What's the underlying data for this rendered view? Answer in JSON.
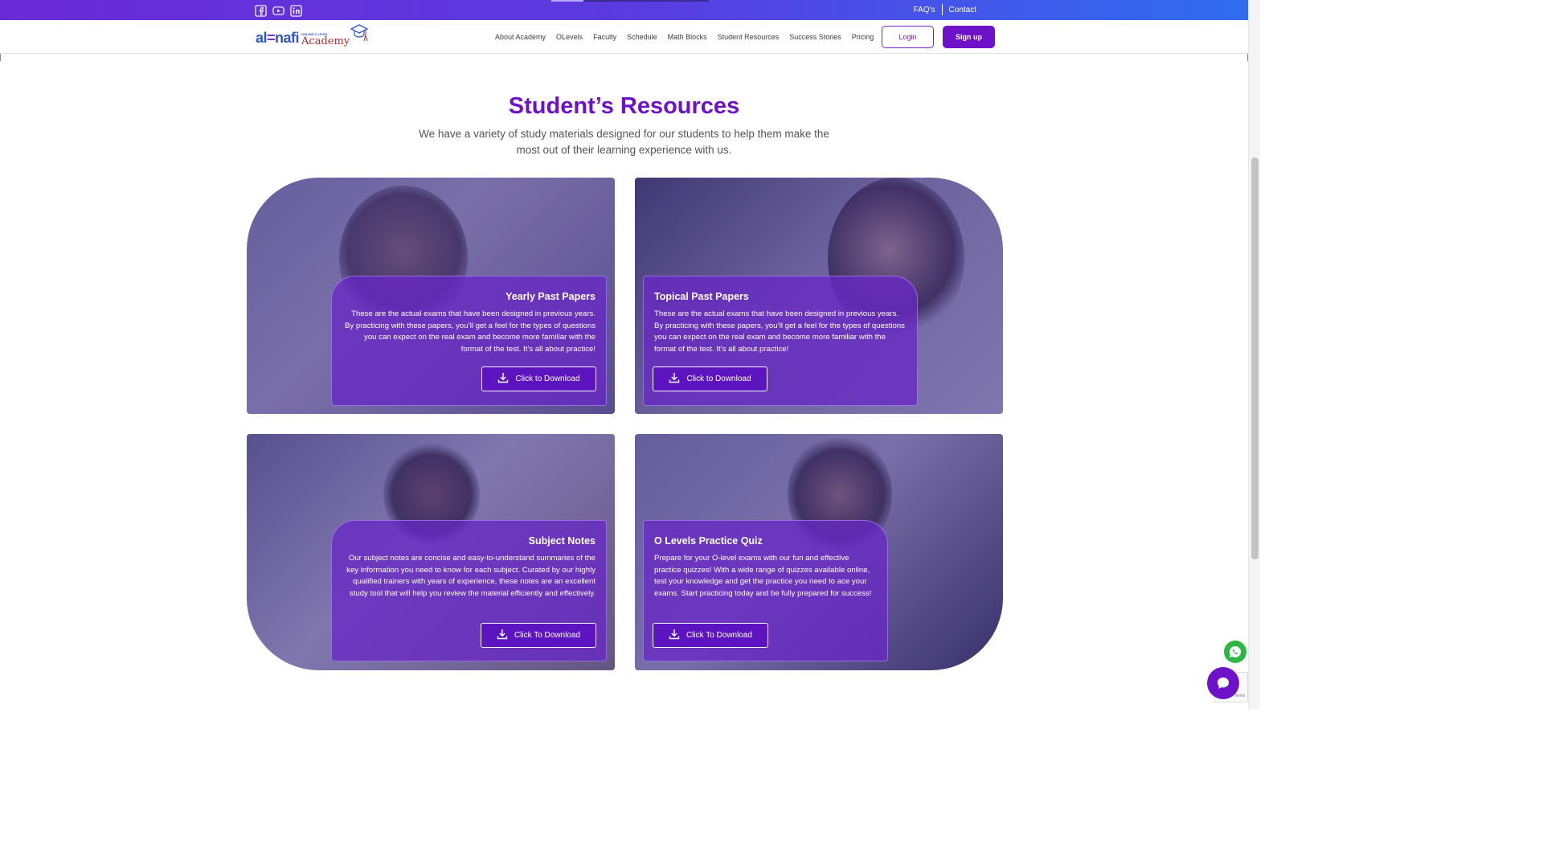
{
  "topbar": {
    "links": [
      "FAQ's",
      "Contact"
    ]
  },
  "nav": {
    "logo": {
      "main_left": "al",
      "main_eq": "=",
      "main_right": "nafi",
      "tagline": "ONLINE O LEVEL",
      "academy": "Academy"
    },
    "items": [
      "About Academy",
      "OLevels",
      "Faculty",
      "Schedule",
      "Math Blocks",
      "Student Resources",
      "Success Stories",
      "Pricing"
    ],
    "login": "Login",
    "signup": "Sign up"
  },
  "section": {
    "title": "Student’s Resources",
    "subtitle": "We have a variety of study materials designed for our students to help them make the most out of their learning experience with us."
  },
  "cards": [
    {
      "title": "Yearly Past Papers",
      "text": "These are the actual exams that have been designed in previous years. By practicing with these papers, you’ll get a feel for the types of questions you can expect on the real exam and become more familiar with the format of the test. It’s all about practice!",
      "button": "Click to Download"
    },
    {
      "title": "Topical Past Papers",
      "text": "These are the actual exams that have been designed in previous years. By practicing with these papers, you’ll get a feel for the types of questions you can expect on the real exam and become more familiar with the format of the test. It’s all about practice!",
      "button": "Click to Download"
    },
    {
      "title": "Subject Notes",
      "text": "Our subject notes are concise and easy-to-understand summaries of the key information you need to know for each subject. Curated by our highly qualified trainers with years of experience, these notes are an excellent study tool that will help you review the material efficiently and effectively.",
      "button": "Click To Download"
    },
    {
      "title": "O Levels Practice Quiz",
      "text": "Prepare for your O-level exams with our fun and effective practice quizzes! With a wide range of quizzes available online, test your knowledge and get the practice you need to ace your exams. Start practicing today and be fully prepared for success!",
      "button": "Click To Download"
    }
  ],
  "colors": {
    "brand_purple": "#6d12c8",
    "topbar_gradient_start": "#6a2bd6",
    "topbar_gradient_end": "#2f6df0",
    "whatsapp_green": "#2db742"
  },
  "icons": [
    "facebook-icon",
    "youtube-icon",
    "linkedin-icon",
    "download-icon",
    "whatsapp-icon",
    "chat-icon",
    "recaptcha-icon"
  ],
  "recaptcha": "Privacy - Terms"
}
